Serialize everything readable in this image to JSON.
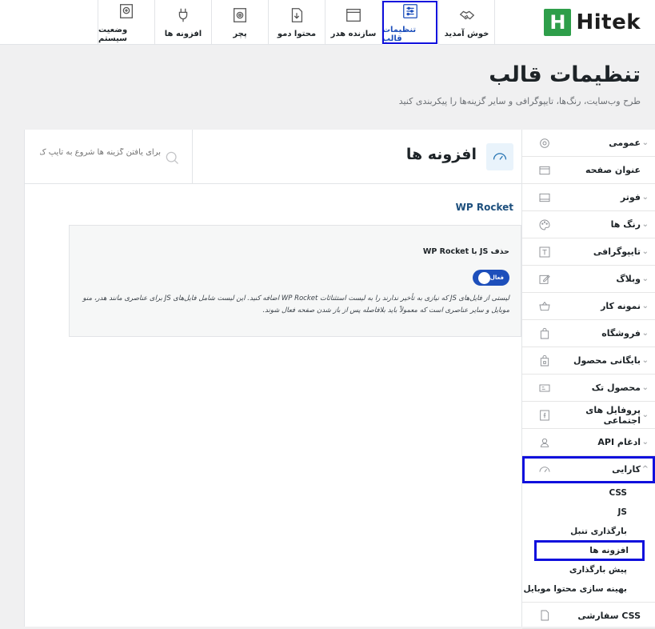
{
  "brand": {
    "mark": "H",
    "name": "Hitek",
    "color": "#2e9e4a"
  },
  "tabs": [
    {
      "label": "خوش آمدید",
      "icon": "handshake-icon"
    },
    {
      "label": "تنظیمات قالب",
      "icon": "sliders-icon",
      "active": true
    },
    {
      "label": "سازنده هدر",
      "icon": "window-icon"
    },
    {
      "label": "محتوا دمو",
      "icon": "download-doc-icon"
    },
    {
      "label": "پچر",
      "icon": "gear-doc-icon"
    },
    {
      "label": "افزونه ها",
      "icon": "plug-icon"
    },
    {
      "label": "وضعیت سیستم",
      "icon": "gear-search-icon"
    }
  ],
  "page": {
    "title": "تنظیمات قالب",
    "subtitle": "طرح وب‌سایت، رنگ‌ها، تایپوگرافی و سایر گزینه‌ها را پیکربندی کنید"
  },
  "sidebar": {
    "items": [
      {
        "label": "عمومی",
        "icon": "gear-icon",
        "chevron": true
      },
      {
        "label": "عنوان صفحه",
        "icon": "title-bar-icon",
        "chevron": false
      },
      {
        "label": "فوتر",
        "icon": "footer-icon",
        "chevron": true
      },
      {
        "label": "رنگ ها",
        "icon": "palette-icon",
        "chevron": true
      },
      {
        "label": "تایپوگرافی",
        "icon": "typography-icon",
        "chevron": true
      },
      {
        "label": "وبلاگ",
        "icon": "edit-icon",
        "chevron": true
      },
      {
        "label": "نمونه کار",
        "icon": "basket-icon",
        "chevron": true
      },
      {
        "label": "فروشگاه",
        "icon": "bag-icon",
        "chevron": true
      },
      {
        "label": "بایگانی محصول",
        "icon": "bag-lock-icon",
        "chevron": true
      },
      {
        "label": "محصول تک",
        "icon": "product-icon",
        "chevron": true
      },
      {
        "label": "پروفایل های اجتماعی",
        "icon": "social-icon",
        "chevron": true
      },
      {
        "label": "ادغام API",
        "icon": "api-icon",
        "chevron": true
      }
    ],
    "performance": {
      "label": "کارایی",
      "icon": "gauge-icon",
      "chevron": "^",
      "subitems": [
        "CSS",
        "JS",
        "بارگذاری تنبل",
        "افزونه ها",
        "پیش بارگذاری",
        "بهینه سازی محتوا موبایل"
      ],
      "active_subitem": 3
    },
    "last_item": {
      "label": "CSS سفارشی",
      "icon": "css-file-icon"
    }
  },
  "panel": {
    "title": "افزونه ها",
    "icon": "gauge-icon",
    "search_placeholder": "برای یافتن گزینه ها شروع به تایپ ک",
    "section_title": "WP Rocket",
    "card": {
      "label": "حذف JS با WP Rocket",
      "toggle_text": "فعال",
      "toggle_on": true,
      "description": "لیستی از فایل‌های JS که نیازی به تأخیر ندارند را به لیست استثنائات WP Rocket اضافه کنید. این لیست شامل فایل‌های JS برای عناصری مانند هدر، منو موبایل و سایر عناصری است که معمولاً باید بلافاصله پس از باز شدن صفحه فعال شوند."
    }
  },
  "colors": {
    "accent": "#1d4fbb",
    "highlight": "#1010dd",
    "section_title": "#1d4f7d"
  }
}
